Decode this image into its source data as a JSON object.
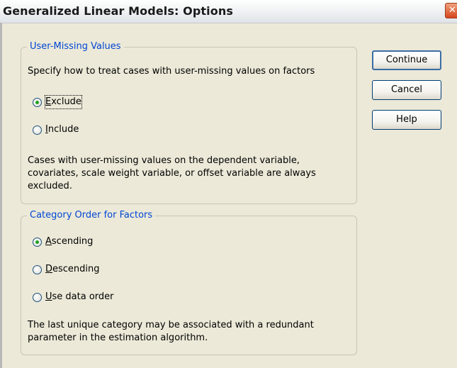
{
  "dialog": {
    "title": "Generalized Linear Models: Options"
  },
  "user_missing": {
    "legend": "User-Missing Values",
    "description": "Specify how to treat cases with user-missing values on factors",
    "options": [
      {
        "mnemonic": "E",
        "rest": "xclude",
        "checked": true
      },
      {
        "mnemonic": "I",
        "rest": "nclude",
        "checked": false
      }
    ],
    "note_lines": [
      "Cases with user-missing values on the dependent variable,",
      "covariates, scale weight variable, or offset variable are always",
      "excluded."
    ]
  },
  "category_order": {
    "legend": "Category Order for Factors",
    "options": [
      {
        "mnemonic": "A",
        "rest": "scending",
        "checked": true
      },
      {
        "mnemonic": "D",
        "rest": "escending",
        "checked": false
      },
      {
        "mnemonic": "U",
        "rest": "se data order",
        "checked": false
      }
    ],
    "note_lines": [
      "The last unique category may be associated with a redundant",
      "parameter in the estimation algorithm."
    ]
  },
  "buttons": {
    "continue": "Continue",
    "cancel": "Cancel",
    "help": "Help"
  },
  "colors": {
    "legend": "#0046d5",
    "radio_dot": "#21a121",
    "dialog_bg": "#ece9d8"
  }
}
